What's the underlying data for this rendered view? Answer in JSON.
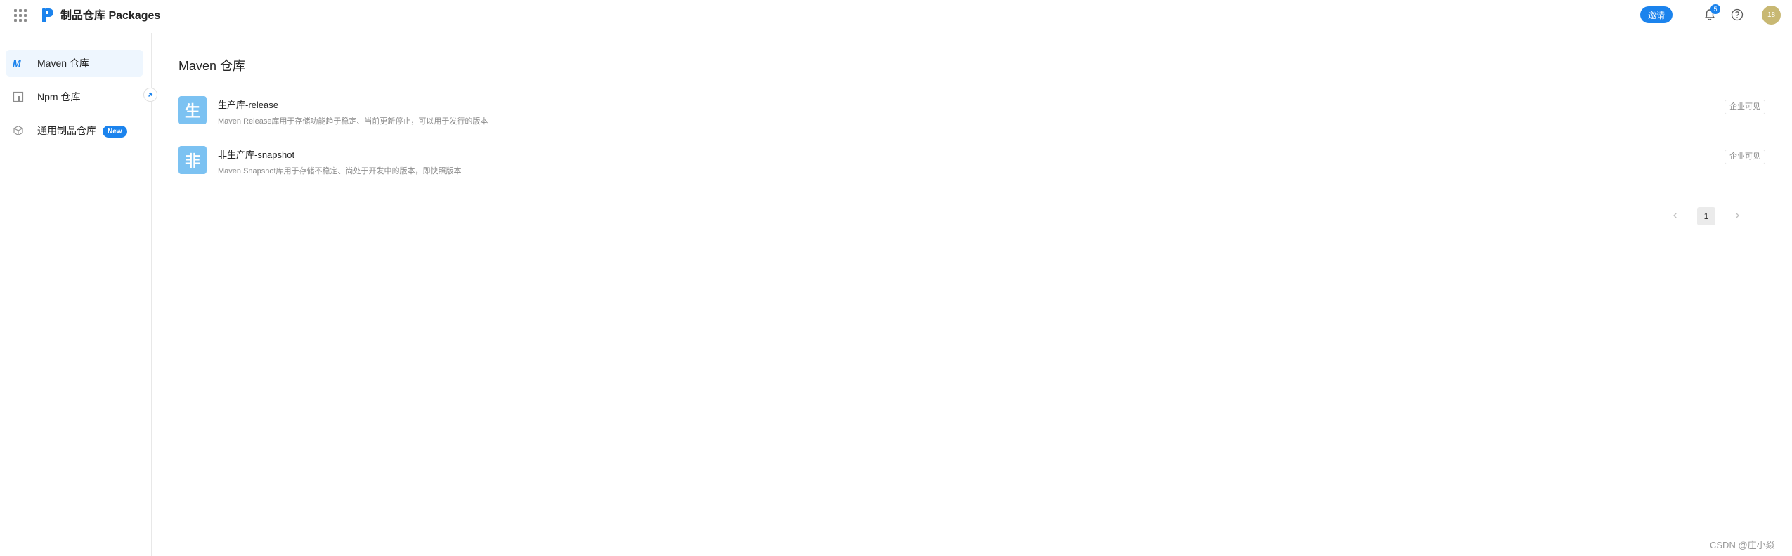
{
  "header": {
    "app_title": "制品仓库 Packages",
    "invite_label": "邀请",
    "notification_count": "5",
    "avatar_initials": "18",
    "icons": [
      "apps-grid-icon",
      "packages-logo-icon",
      "bell-icon",
      "help-icon"
    ],
    "accent_color": "#1b83ed"
  },
  "sidebar": {
    "items": [
      {
        "label": "Maven 仓库",
        "icon": "maven-icon",
        "active": true
      },
      {
        "label": "Npm 仓库",
        "icon": "npm-icon",
        "active": false
      },
      {
        "label": "通用制品仓库",
        "icon": "cube-icon",
        "active": false,
        "badge": "New"
      }
    ]
  },
  "main": {
    "title": "Maven 仓库",
    "repos": [
      {
        "avatar_char": "生",
        "name": "生产库-release",
        "description": "Maven Release库用于存储功能趋于稳定、当前更新停止，可以用于发行的版本",
        "visibility": "企业可见"
      },
      {
        "avatar_char": "非",
        "name": "非生产库-snapshot",
        "description": "Maven Snapshot库用于存储不稳定、尚处于开发中的版本，即快照版本",
        "visibility": "企业可见"
      }
    ],
    "pagination": {
      "current_page": "1"
    }
  },
  "watermark": "CSDN @庄小焱"
}
